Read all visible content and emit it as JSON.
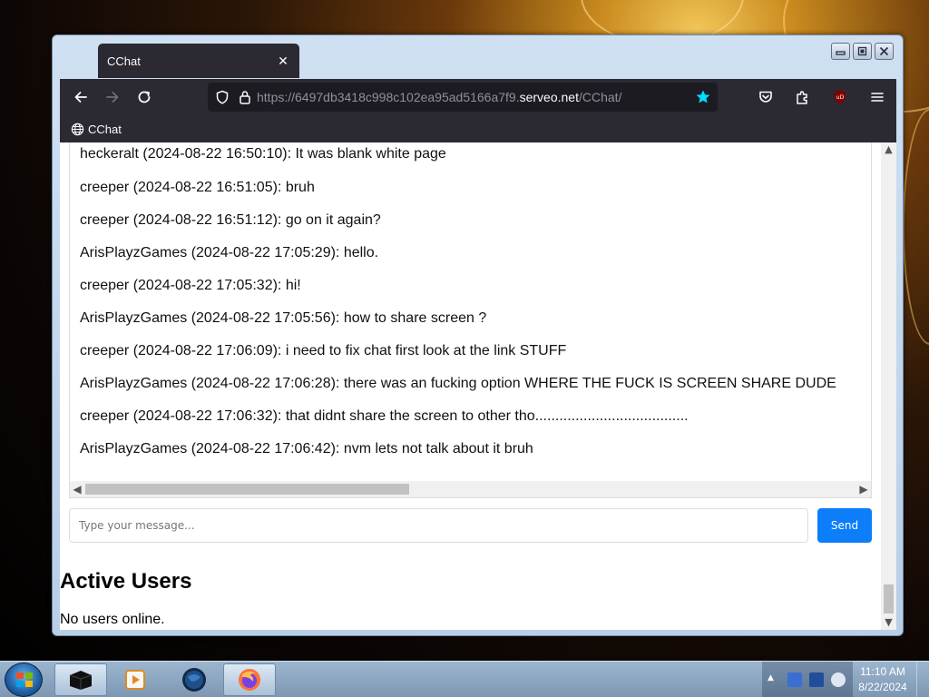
{
  "browser": {
    "tab_title": "CChat",
    "url_prefix": "https://6497db3418c998c102ea95ad5166a7f9.",
    "url_host": "serveo.net",
    "url_path": "/CChat/",
    "bookmark_label": "CChat"
  },
  "chat": {
    "messages": [
      {
        "text": "heckeralt (2024-08-22 16:50:10): It was blank white page"
      },
      {
        "text": "creeper (2024-08-22 16:51:05): bruh"
      },
      {
        "text": "creeper (2024-08-22 16:51:12): go on it again?"
      },
      {
        "text": "ArisPlayzGames (2024-08-22 17:05:29): hello."
      },
      {
        "text": "creeper (2024-08-22 17:05:32): hi!"
      },
      {
        "text": "ArisPlayzGames (2024-08-22 17:05:56): how to share screen ?"
      },
      {
        "text": "creeper (2024-08-22 17:06:09): i need to fix chat first look at the link STUFF"
      },
      {
        "text": "ArisPlayzGames (2024-08-22 17:06:28): there was an fucking option WHERE THE FUCK IS SCREEN SHARE DUDE"
      },
      {
        "text": "creeper (2024-08-22 17:06:32): that didnt share the screen to other tho......................................"
      },
      {
        "text": "ArisPlayzGames (2024-08-22 17:06:42): nvm lets not talk about it bruh"
      }
    ],
    "input_placeholder": "Type your message...",
    "input_value": "",
    "send_label": "Send"
  },
  "users": {
    "title": "Active Users",
    "status": "No users online."
  },
  "taskbar": {
    "time": "11:10 AM",
    "date": "8/22/2024"
  },
  "icons": {
    "back": "arrow-left-icon",
    "forward": "arrow-right-icon",
    "reload": "reload-icon",
    "shield": "shield-icon",
    "lock": "lock-icon",
    "bookmark_star": "star-icon",
    "pocket": "pocket-icon",
    "extensions": "puzzle-icon",
    "ublock": "ublock-icon",
    "menu": "hamburger-icon",
    "globe": "globe-icon"
  },
  "colors": {
    "browser_dark": "#2b2a33",
    "urlbar_bg": "#1c1b22",
    "star": "#00ddff",
    "send_button": "#0d7efa"
  }
}
